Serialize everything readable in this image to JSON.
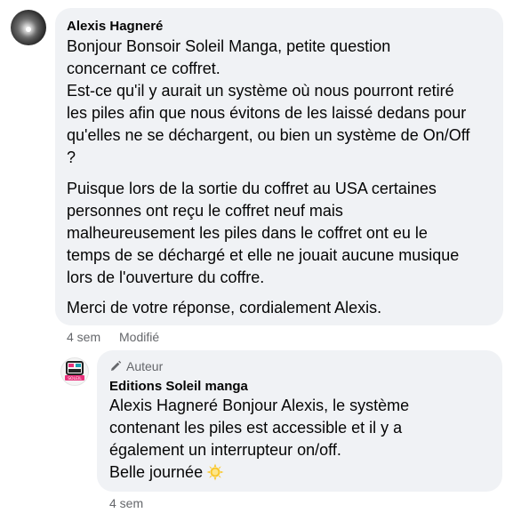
{
  "comment": {
    "author": "Alexis Hagneré",
    "paragraph1": "Bonjour Bonsoir Soleil Manga, petite question\nconcernant ce coffret.\nEst-ce qu'il y aurait un système où nous pourront retiré\nles piles afin que nous évitons de les laissé dedans pour\nqu'elles ne se déchargent, ou bien un système de On/Off\n?",
    "paragraph2": "Puisque lors de la sortie du coffret au USA certaines\npersonnes ont reçu le coffret neuf mais\nmalheureusement les piles dans le coffret ont eu le\ntemps de se déchargé et elle ne jouait aucune musique\nlors de l'ouverture du coffre.",
    "paragraph3": "Merci de votre réponse, cordialement Alexis.",
    "time": "4 sem",
    "edited": "Modifié"
  },
  "reply": {
    "badge": "Auteur",
    "author": "Editions Soleil manga",
    "text": "Alexis Hagneré Bonjour Alexis, le système\ncontenant les piles est accessible et il y a\négalement un interrupteur on/off.\nBelle journée",
    "emoji": "sun-emoji",
    "time": "4 sem",
    "avatar_logo_text": "SOLEIL",
    "colors": {
      "sun": "#f9c72a",
      "logo_pink": "#e8307a",
      "logo_teal": "#1a9fb0"
    }
  },
  "colors": {
    "bubble": "#f0f2f5",
    "meta": "#65676b",
    "text": "#050505"
  }
}
